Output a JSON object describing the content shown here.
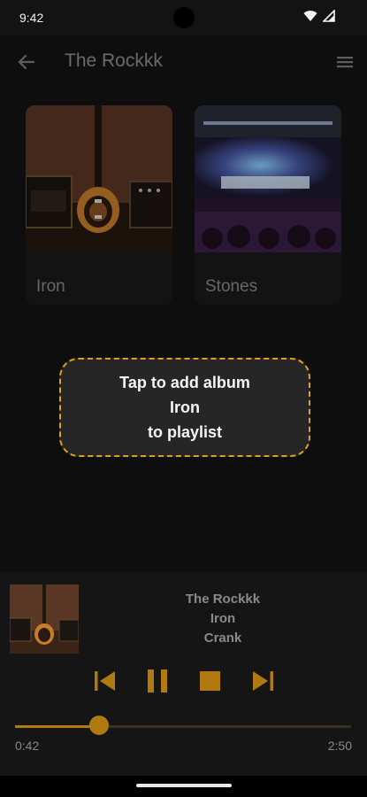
{
  "status": {
    "time": "9:42"
  },
  "app_bar": {
    "title": "The Rockkk"
  },
  "albums": [
    {
      "name": "Iron"
    },
    {
      "name": "Stones"
    }
  ],
  "toast": {
    "lines": [
      "Tap to add album",
      "Iron",
      "to playlist"
    ]
  },
  "player": {
    "artist": "The Rockkk",
    "album": "Iron",
    "track": "Crank",
    "current_time": "0:42",
    "total_time": "2:50",
    "progress": 0.25
  },
  "colors": {
    "accent": "#b07a10",
    "toast_border": "#e0a020",
    "background": "#131313"
  },
  "icons": {
    "back": "arrow-left-icon",
    "menu": "hamburger-icon",
    "wifi": "wifi-icon",
    "signal": "signal-icon",
    "prev": "skip-previous-icon",
    "pause": "pause-icon",
    "stop": "stop-icon",
    "next": "skip-next-icon"
  }
}
